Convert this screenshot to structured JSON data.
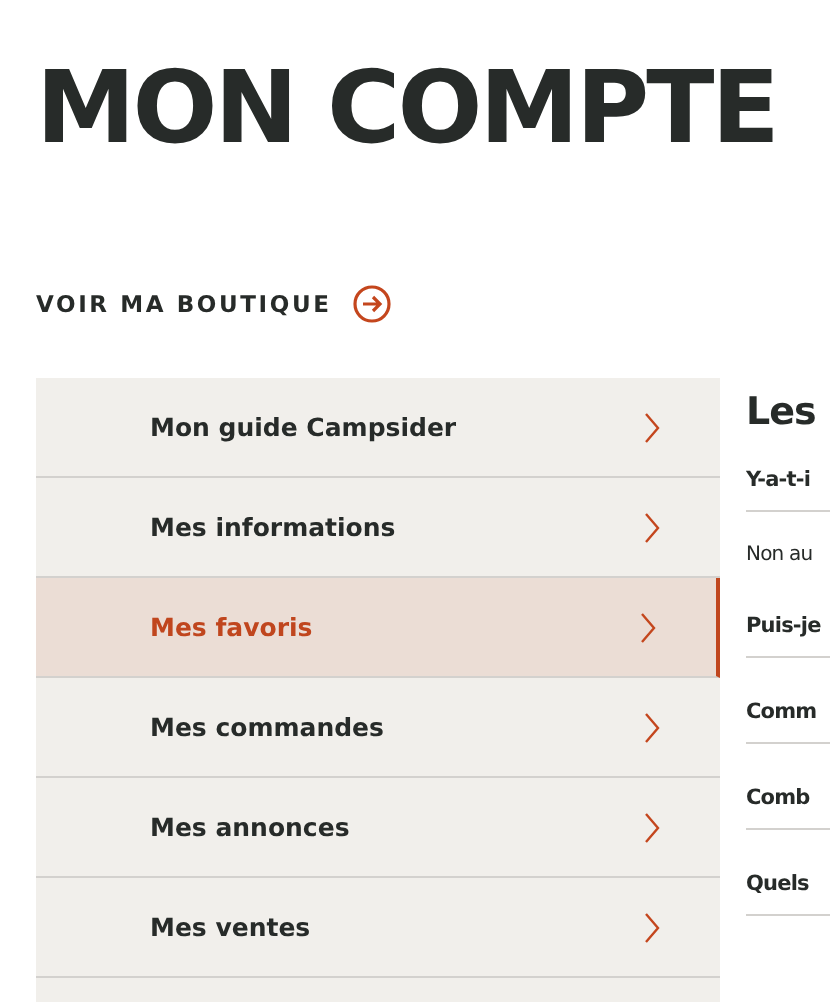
{
  "page_title": "MON COMPTE",
  "shop_link": {
    "label": "VOIR MA BOUTIQUE"
  },
  "sidebar": {
    "items": [
      {
        "label": "Mon guide Campsider",
        "selected": false
      },
      {
        "label": "Mes informations",
        "selected": false
      },
      {
        "label": "Mes favoris",
        "selected": true
      },
      {
        "label": "Mes commandes",
        "selected": false
      },
      {
        "label": "Mes annonces",
        "selected": false
      },
      {
        "label": "Mes ventes",
        "selected": false
      }
    ]
  },
  "faq": {
    "heading": "Les",
    "entries": [
      {
        "kind": "question",
        "text": "Y-a-t-i"
      },
      {
        "kind": "answer",
        "text": "Non au"
      },
      {
        "kind": "question",
        "text": "Puis-je"
      },
      {
        "kind": "question",
        "text": "Comm"
      },
      {
        "kind": "question",
        "text": "Comb"
      },
      {
        "kind": "question",
        "text": "Quels"
      }
    ]
  }
}
